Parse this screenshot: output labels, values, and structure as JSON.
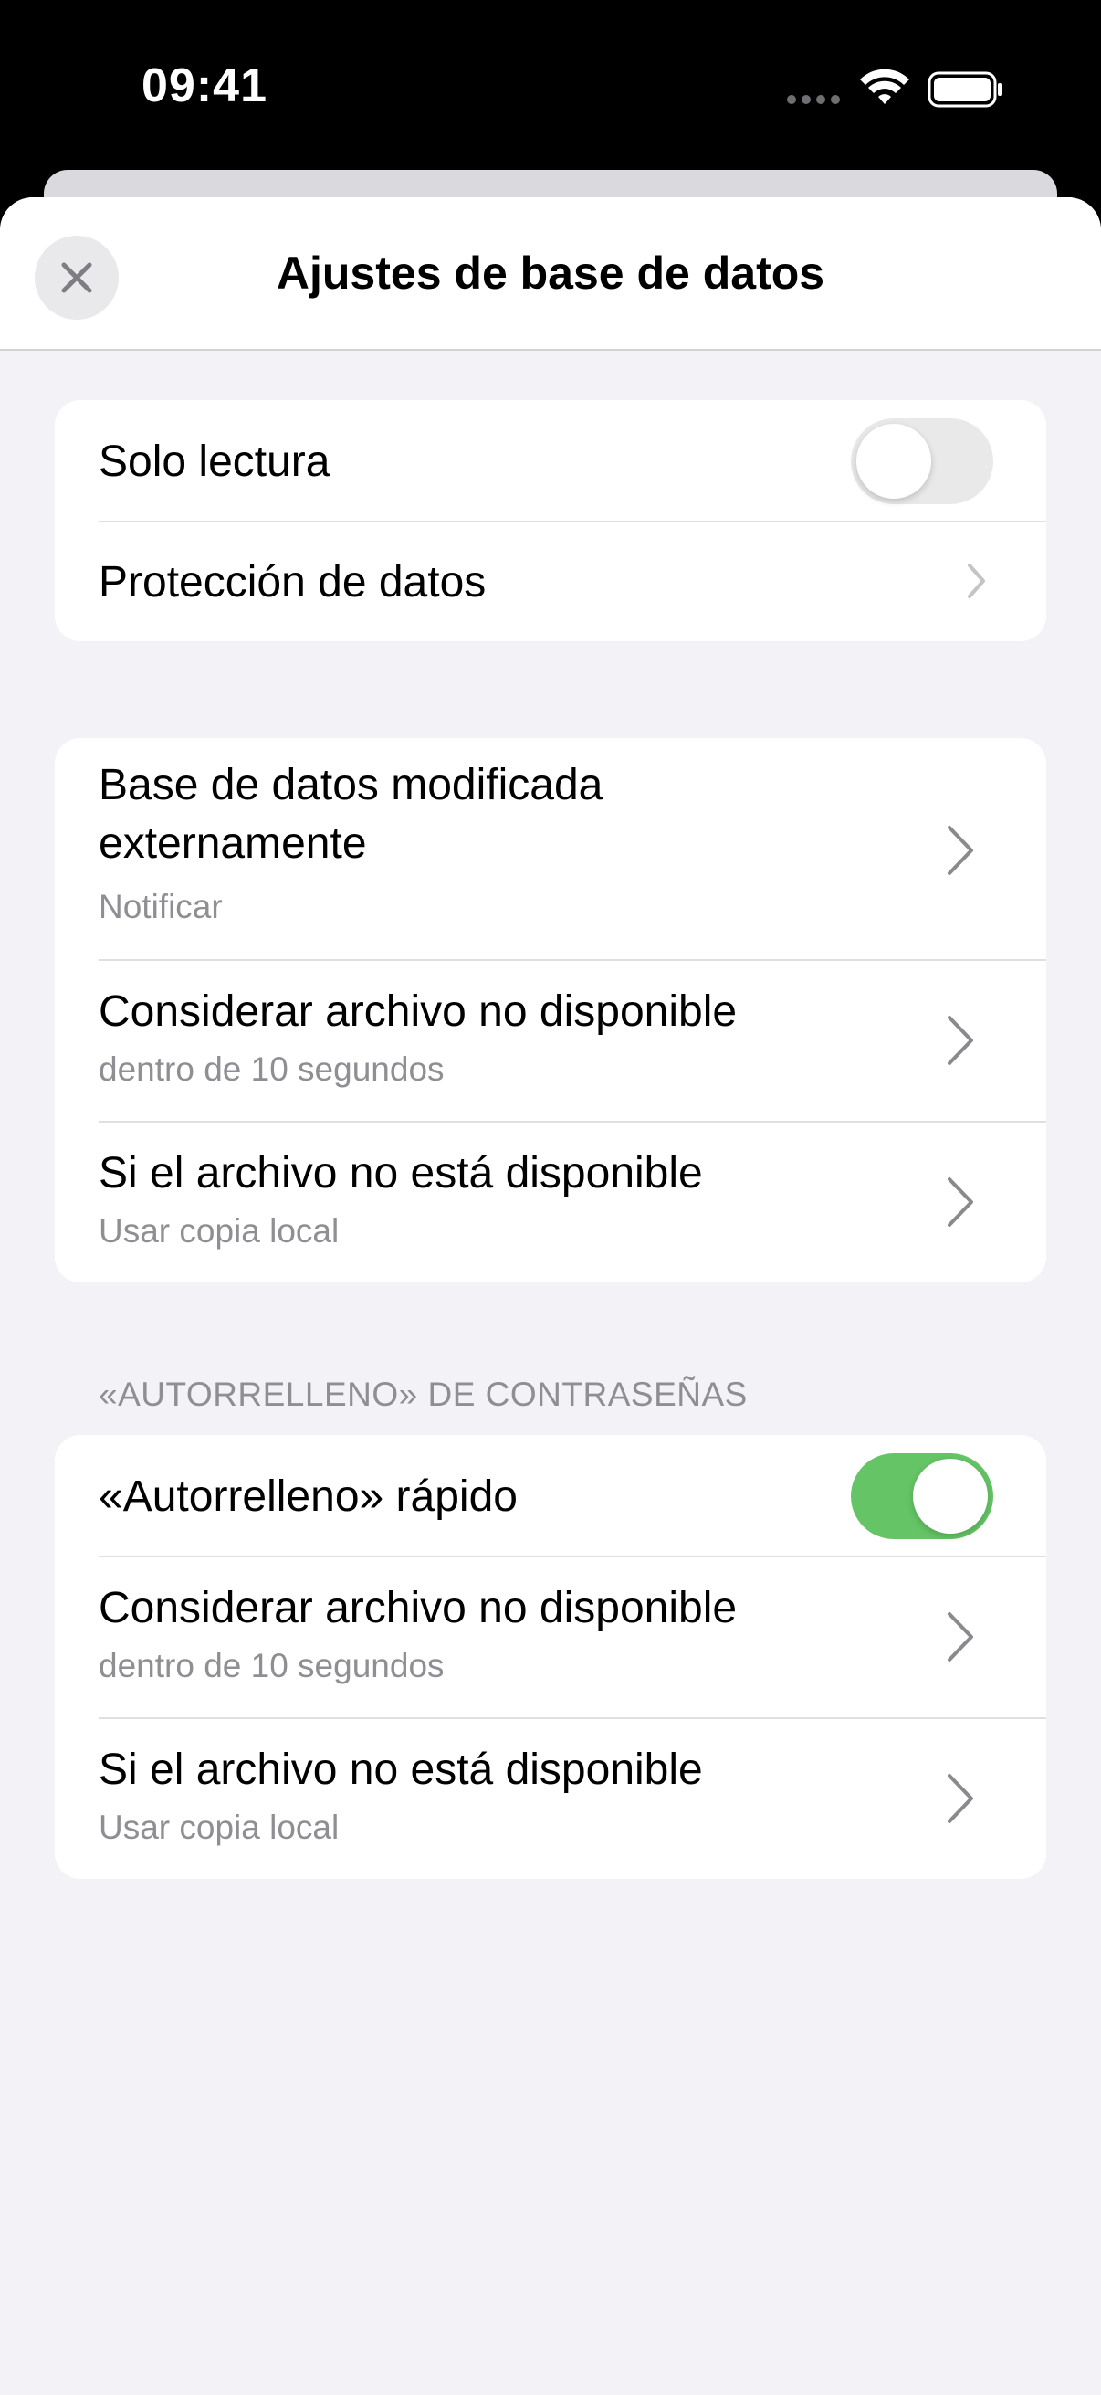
{
  "status_bar": {
    "time": "09:41",
    "icons": [
      "cellular-dots-icon",
      "wifi-icon",
      "battery-icon"
    ]
  },
  "nav": {
    "title": "Ajustes de base de datos",
    "close_icon": "close-icon"
  },
  "group1": {
    "read_only": {
      "label": "Solo lectura",
      "toggle_on": false
    },
    "data_protection": {
      "label": "Protección de datos"
    }
  },
  "group2": {
    "external_change": {
      "label_line1": "Base de datos modificada",
      "label_line2": "externamente",
      "value": "Notificar"
    },
    "unavailable_timeout": {
      "label": "Considerar archivo no disponible",
      "value": "dentro de 10 segundos"
    },
    "unavailable_action": {
      "label": "Si el archivo no está disponible",
      "value": "Usar copia local"
    }
  },
  "autofill": {
    "header": "«AUTORRELLENO» DE CONTRASEÑAS",
    "quick_autofill": {
      "label": "«Autorrelleno» rápido",
      "toggle_on": true
    },
    "unavailable_timeout": {
      "label": "Considerar archivo no disponible",
      "value": "dentro de 10 segundos"
    },
    "unavailable_action": {
      "label": "Si el archivo no está disponible",
      "value": "Usar copia local"
    }
  },
  "colors": {
    "toggle_on": "#65c466",
    "toggle_off": "#e9e9ea",
    "background": "#f2f2f7",
    "secondary_text": "#8e8e93"
  }
}
